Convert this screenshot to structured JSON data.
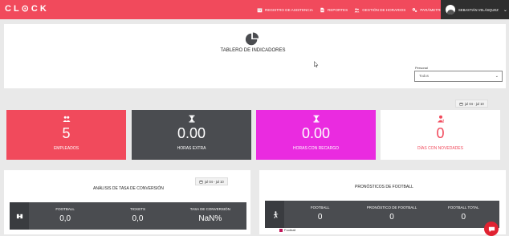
{
  "brand": {
    "logo_text": "CL⊙CK",
    "accent": "#f14a5c"
  },
  "nav": [
    {
      "icon": "calendar-icon",
      "label": "Registro de asistencia"
    },
    {
      "icon": "document-icon",
      "label": "Reportes"
    },
    {
      "icon": "users-icon",
      "label": "Gestión de horarios"
    },
    {
      "icon": "gears-icon",
      "label": "Parámetros"
    }
  ],
  "user": {
    "name": "Sebastián Velásquez"
  },
  "dashboard": {
    "title": "Tablero de indicadores",
    "personal_label": "Personal",
    "personal_value": "Todos",
    "date_range": "jul 04 - jul 10"
  },
  "cards": [
    {
      "icon": "users-icon",
      "value": "5",
      "label": "Empleados",
      "bg": "#f14a5c",
      "fg": "#ffffff"
    },
    {
      "icon": "hourglass-icon",
      "value": "0.00",
      "label": "Horas extra",
      "bg": "#4a4c50",
      "fg": "#ffffff"
    },
    {
      "icon": "hourglass-icon",
      "value": "0.00",
      "label": "Horas con recargo",
      "bg": "#ea2be0",
      "fg": "#ffffff"
    },
    {
      "icon": "user-alert-icon",
      "value": "0",
      "label": "Días con novedades",
      "bg": "#ffffff",
      "fg": "#f14a5c"
    }
  ],
  "conversion": {
    "title": "Análisis de tasa de conversión",
    "date_range": "jul 04 - jul 10",
    "columns": [
      {
        "head": "Football",
        "value": "0,0"
      },
      {
        "head": "Tickets",
        "value": "0,0"
      },
      {
        "head": "Tasa de conversión",
        "value": "NaN%"
      }
    ]
  },
  "forecast": {
    "title": "Pronósticos de football",
    "columns": [
      {
        "head": "Football",
        "value": "0"
      },
      {
        "head": "Pronóstico de football",
        "value": "0"
      },
      {
        "head": "Football total",
        "value": "0"
      }
    ],
    "legend": "Football"
  }
}
